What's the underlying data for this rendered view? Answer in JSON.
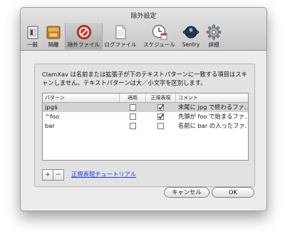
{
  "window": {
    "title": "除外設定"
  },
  "toolbar": {
    "items": [
      {
        "label": "一般",
        "icon": "general-switch-icon"
      },
      {
        "label": "隔離",
        "icon": "quarantine-box-icon"
      },
      {
        "label": "除外ファイル",
        "icon": "no-entry-icon",
        "selected": true
      },
      {
        "label": "ログファイル",
        "icon": "log-document-icon"
      },
      {
        "label": "スケジュール",
        "icon": "clock-calendar-icon"
      },
      {
        "label": "Sentry",
        "icon": "sentry-icon"
      },
      {
        "label": "詳細",
        "icon": "gear-icon"
      }
    ]
  },
  "description": "ClamXav は名前または拡張子が下のテキストパターンに一致する項目はスキャンしません。テキストパターンは大／小文字を区別します。",
  "table": {
    "columns": [
      "パターン",
      "適用",
      "正規表現",
      "コメント"
    ],
    "rows": [
      {
        "pattern": "jpg$",
        "apply": false,
        "regex": true,
        "comment": "末尾に jpg で終わるファ…",
        "selected": true
      },
      {
        "pattern": "^foo",
        "apply": false,
        "regex": true,
        "comment": "先頭が foo で始まるファ…"
      },
      {
        "pattern": "bar",
        "apply": false,
        "regex": false,
        "comment": "名前に bar の入ったファ…"
      }
    ]
  },
  "bottom": {
    "add_label": "+",
    "remove_label": "−",
    "tutorial_link": "正規表現チュートリアル"
  },
  "buttons": {
    "cancel_label": "キャンセル",
    "ok_label": "OK"
  },
  "colors": {
    "link": "#1b3fd6",
    "selected_row": "#d3d3d3",
    "window_bg": "#ececec"
  }
}
